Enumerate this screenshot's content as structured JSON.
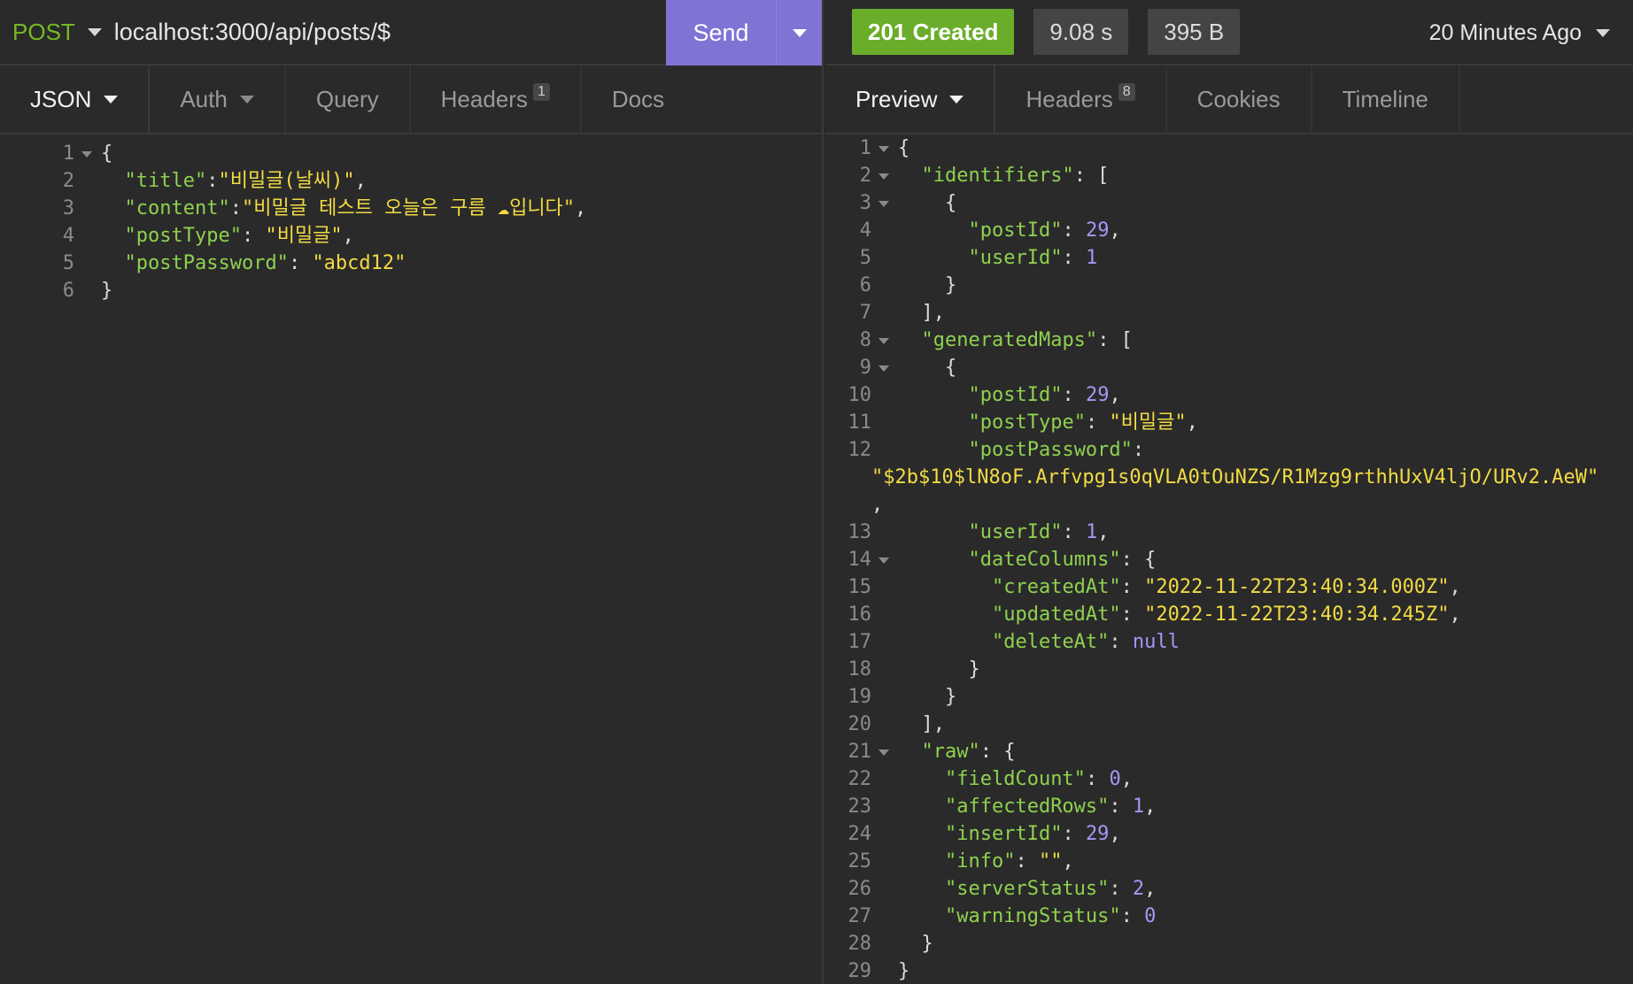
{
  "request": {
    "method": "POST",
    "url": "localhost:3000/api/posts/$",
    "send_label": "Send",
    "tabs": [
      {
        "label": "JSON",
        "badge": ""
      },
      {
        "label": "Auth",
        "badge": ""
      },
      {
        "label": "Query",
        "badge": ""
      },
      {
        "label": "Headers",
        "badge": "1"
      },
      {
        "label": "Docs",
        "badge": ""
      }
    ],
    "body_lines": [
      "{",
      "  \"title\":\"비밀글(날씨)\",",
      "  \"content\":\"비밀글 테스트 오늘은 구름 ☁입니다\",",
      "  \"postType\": \"비밀글\",",
      "  \"postPassword\": \"abcd12\"",
      "}"
    ]
  },
  "response": {
    "status": "201 Created",
    "time": "9.08 s",
    "size": "395 B",
    "ago": "20 Minutes Ago",
    "tabs": [
      {
        "label": "Preview",
        "badge": ""
      },
      {
        "label": "Headers",
        "badge": "8"
      },
      {
        "label": "Cookies",
        "badge": ""
      },
      {
        "label": "Timeline",
        "badge": ""
      }
    ],
    "lines": [
      {
        "n": "1",
        "t": "{"
      },
      {
        "n": "2",
        "t": "  \"identifiers\": ["
      },
      {
        "n": "3",
        "t": "    {"
      },
      {
        "n": "4",
        "t": "      \"postId\": 29,"
      },
      {
        "n": "5",
        "t": "      \"userId\": 1"
      },
      {
        "n": "6",
        "t": "    }"
      },
      {
        "n": "7",
        "t": "  ],"
      },
      {
        "n": "8",
        "t": "  \"generatedMaps\": ["
      },
      {
        "n": "9",
        "t": "    {"
      },
      {
        "n": "10",
        "t": "      \"postId\": 29,"
      },
      {
        "n": "11",
        "t": "      \"postType\": \"비밀글\","
      },
      {
        "n": "12",
        "t": "      \"postPassword\":\n\"$2b$10$lN8oF.Arfvpg1s0qVLA0tOuNZS/R1Mzg9rthhUxV4ljO/URv2.AeW\"\n,"
      },
      {
        "n": "13",
        "t": "      \"userId\": 1,"
      },
      {
        "n": "14",
        "t": "      \"dateColumns\": {"
      },
      {
        "n": "15",
        "t": "        \"createdAt\": \"2022-11-22T23:40:34.000Z\","
      },
      {
        "n": "16",
        "t": "        \"updatedAt\": \"2022-11-22T23:40:34.245Z\","
      },
      {
        "n": "17",
        "t": "        \"deleteAt\": null"
      },
      {
        "n": "18",
        "t": "      }"
      },
      {
        "n": "19",
        "t": "    }"
      },
      {
        "n": "20",
        "t": "  ],"
      },
      {
        "n": "21",
        "t": "  \"raw\": {"
      },
      {
        "n": "22",
        "t": "    \"fieldCount\": 0,"
      },
      {
        "n": "23",
        "t": "    \"affectedRows\": 1,"
      },
      {
        "n": "24",
        "t": "    \"insertId\": 29,"
      },
      {
        "n": "25",
        "t": "    \"info\": \"\","
      },
      {
        "n": "26",
        "t": "    \"serverStatus\": 2,"
      },
      {
        "n": "27",
        "t": "    \"warningStatus\": 0"
      },
      {
        "n": "28",
        "t": "  }"
      },
      {
        "n": "29",
        "t": "}"
      }
    ]
  }
}
